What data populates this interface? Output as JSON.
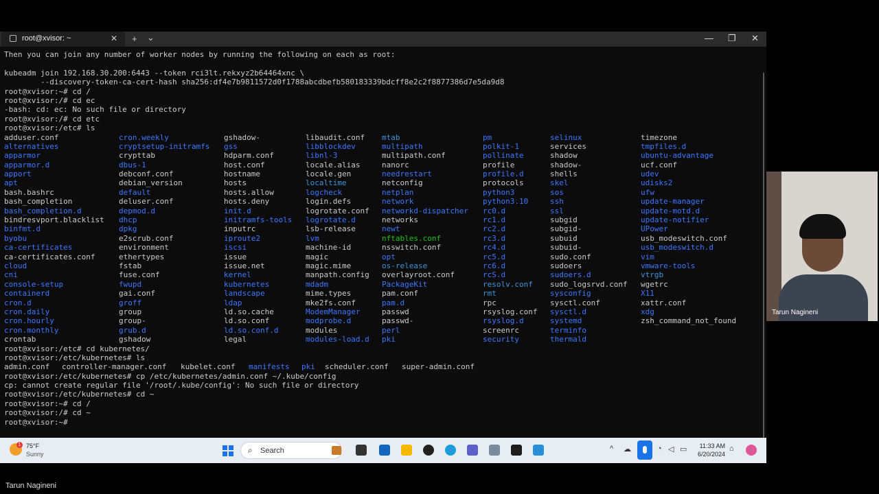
{
  "window": {
    "tab_title": "root@xvisor: ~",
    "close_tab": "✕",
    "new_tab": "+",
    "dropdown": "⌄",
    "minimize": "—",
    "maximize": "❐",
    "close": "✕"
  },
  "terminal": {
    "pre_lines": [
      {
        "text": "Then you can join any number of worker nodes by running the following on each as root:",
        "color": "default"
      },
      {
        "text": "",
        "color": "default"
      },
      {
        "text": "kubeadm join 192.168.30.200:6443 --token rci3lt.rekxyz2b64464xnc \\",
        "color": "default"
      },
      {
        "text": "        --discovery-token-ca-cert-hash sha256:df4e7b9811572d0f1788abcdbefb580183339bdcff8e2c2f8877386d7e5da9d8",
        "color": "default"
      },
      {
        "text": "root@xvisor:~# cd /",
        "color": "default"
      },
      {
        "text": "root@xvisor:/# cd ec",
        "color": "default"
      },
      {
        "text": "-bash: cd: ec: No such file or directory",
        "color": "default"
      },
      {
        "text": "root@xvisor:/# cd etc",
        "color": "default"
      },
      {
        "text": "root@xvisor:/etc# ls",
        "color": "default"
      }
    ],
    "ls_columns": [
      [
        "adduser.conf:d",
        "alternatives:b",
        "apparmor:b",
        "apparmor.d:b",
        "apport:b",
        "apt:b",
        "bash.bashrc:d",
        "bash_completion:d",
        "bash_completion.d:b",
        "bindresvport.blacklist:d",
        "binfmt.d:b",
        "byobu:b",
        "ca-certificates:b",
        "ca-certificates.conf:d",
        "cloud:b",
        "cni:b",
        "console-setup:b",
        "containerd:b",
        "cron.d:b",
        "cron.daily:b",
        "cron.hourly:b",
        "cron.monthly:b",
        "crontab:d"
      ],
      [
        "cron.weekly:b",
        "cryptsetup-initramfs:b",
        "crypttab:d",
        "dbus-1:b",
        "debconf.conf:d",
        "debian_version:d",
        "default:b",
        "deluser.conf:d",
        "depmod.d:b",
        "dhcp:b",
        "dpkg:b",
        "e2scrub.conf:d",
        "environment:d",
        "ethertypes:d",
        "fstab:d",
        "fuse.conf:d",
        "fwupd:b",
        "gai.conf:d",
        "groff:b",
        "group:d",
        "group-:d",
        "grub.d:b",
        "gshadow:d"
      ],
      [
        "gshadow-:d",
        "gss:b",
        "hdparm.conf:d",
        "host.conf:d",
        "hostname:d",
        "hosts:d",
        "hosts.allow:d",
        "hosts.deny:d",
        "init.d:b",
        "initramfs-tools:b",
        "inputrc:d",
        "iproute2:b",
        "iscsi:b",
        "issue:d",
        "issue.net:d",
        "kernel:b",
        "kubernetes:b",
        "landscape:b",
        "ldap:b",
        "ld.so.cache:d",
        "ld.so.conf:d",
        "ld.so.conf.d:b",
        "legal:d"
      ],
      [
        "libaudit.conf:d",
        "libblockdev:b",
        "libnl-3:b",
        "locale.alias:d",
        "locale.gen:d",
        "localtime:c",
        "logcheck:b",
        "login.defs:d",
        "logrotate.conf:d",
        "logrotate.d:b",
        "lsb-release:d",
        "lvm:b",
        "machine-id:d",
        "magic:d",
        "magic.mime:d",
        "manpath.config:d",
        "mdadm:b",
        "mime.types:d",
        "mke2fs.conf:d",
        "ModemManager:b",
        "modprobe.d:b",
        "modules:d",
        "modules-load.d:b"
      ],
      [
        "mtab:c",
        "multipath:b",
        "multipath.conf:d",
        "nanorc:d",
        "needrestart:b",
        "netconfig:d",
        "netplan:b",
        "network:b",
        "networkd-dispatcher:b",
        "networks:d",
        "newt:b",
        "nftables.conf:g",
        "nsswitch.conf:d",
        "opt:b",
        "os-release:c",
        "overlayroot.conf:d",
        "PackageKit:b",
        "pam.conf:d",
        "pam.d:b",
        "passwd:d",
        "passwd-:d",
        "perl:b",
        "pki:b"
      ],
      [
        "pm:b",
        "polkit-1:b",
        "pollinate:b",
        "profile:d",
        "profile.d:b",
        "protocols:d",
        "python3:b",
        "python3.10:b",
        "rc0.d:b",
        "rc1.d:b",
        "rc2.d:b",
        "rc3.d:b",
        "rc4.d:b",
        "rc5.d:b",
        "rc6.d:b",
        "rcS.d:b",
        "resolv.conf:c",
        "rmt:c",
        "rpc:d",
        "rsyslog.conf:d",
        "rsyslog.d:b",
        "screenrc:d",
        "security:b"
      ],
      [
        "selinux:b",
        "services:d",
        "shadow:d",
        "shadow-:d",
        "shells:d",
        "skel:b",
        "sos:b",
        "ssh:b",
        "ssl:b",
        "subgid:d",
        "subgid-:d",
        "subuid:d",
        "subuid-:d",
        "sudo.conf:d",
        "sudoers:d",
        "sudoers.d:b",
        "sudo_logsrvd.conf:d",
        "sysconfig:b",
        "sysctl.conf:d",
        "sysctl.d:b",
        "systemd:b",
        "terminfo:b",
        "thermald:b"
      ],
      [
        "timezone:d",
        "tmpfiles.d:b",
        "ubuntu-advantage:b",
        "ucf.conf:d",
        "udev:b",
        "udisks2:b",
        "ufw:b",
        "update-manager:b",
        "update-motd.d:b",
        "update-notifier:b",
        "UPower:b",
        "usb_modeswitch.conf:d",
        "usb_modeswitch.d:b",
        "vim:b",
        "vmware-tools:b",
        "vtrgb:c",
        "wgetrc:d",
        "X11:b",
        "xattr.conf:d",
        "xdg:b",
        "zsh_command_not_found:d"
      ]
    ],
    "post_lines_1": [
      {
        "text": "root@xvisor:/etc# cd kubernetes/"
      },
      {
        "text": "root@xvisor:/etc/kubernetes# ls"
      }
    ],
    "kube_ls": [
      {
        "text": "admin.conf",
        "color": "d"
      },
      {
        "text": "controller-manager.conf",
        "color": "d"
      },
      {
        "text": "kubelet.conf",
        "color": "d"
      },
      {
        "text": "manifests",
        "color": "b"
      },
      {
        "text": "pki",
        "color": "b"
      },
      {
        "text": "scheduler.conf",
        "color": "d"
      },
      {
        "text": "super-admin.conf",
        "color": "d"
      }
    ],
    "post_lines_2": [
      {
        "text": "root@xvisor:/etc/kubernetes# cp /etc/kubernetes/admin.conf ~/.kube/config"
      },
      {
        "text": "cp: cannot create regular file '/root/.kube/config': No such file or directory"
      },
      {
        "text": "root@xvisor:/etc/kubernetes# cd ~"
      },
      {
        "text": "root@xvisor:~# cd /"
      },
      {
        "text": "root@xvisor:/# cd ~"
      },
      {
        "text": "root@xvisor:~#"
      }
    ],
    "colors": {
      "default": "#cccccc",
      "blue": "#3b78ff",
      "green": "#16c60c",
      "cyan": "#3a96dd"
    }
  },
  "webcam": {
    "name": "Tarun Nagineni"
  },
  "taskbar": {
    "weather_badge": "1",
    "weather_temp": "75°F",
    "weather_desc": "Sunny",
    "search_placeholder": "Search",
    "tray_chevron": "^",
    "time": "11:33 AM",
    "date": "6/20/2024"
  },
  "caption": {
    "name": "Tarun Nagineni"
  }
}
